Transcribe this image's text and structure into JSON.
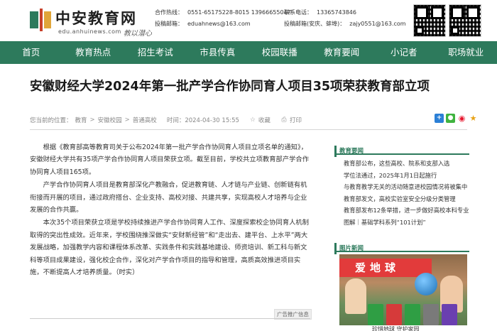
{
  "header": {
    "logo_text": "中安教育网",
    "logo_url": "edu.anhuinews.com",
    "logo_signature": "教以潜心",
    "contacts": {
      "coop_label": "合作热线：",
      "coop_value": "0551-65175228-8015 13966655047",
      "submit_label": "投稿邮箱：",
      "submit_value": "eduahnews@163.com",
      "phone_label": "联系电话：",
      "phone_value": "13365743846",
      "branch_label": "投稿邮箱(安庆、蚌埠)：",
      "branch_value": "zajy0551@163.com"
    }
  },
  "nav": {
    "items": [
      "首页",
      "教育热点",
      "招生考试",
      "市县传真",
      "校园联播",
      "教育要闻",
      "小记者",
      "职场就业"
    ]
  },
  "article": {
    "title": "安徽财经大学2024年第一批产学合作协同育人项目35项荣获教育部立项",
    "meta": {
      "location_label": "您当前的位置：",
      "crumb1": "教育",
      "crumb2": "安徽校园",
      "crumb3": "普通高校",
      "time": "时间：2024-04-30 15:55",
      "favorite": "收藏",
      "print": "打印"
    },
    "paragraphs": [
      "根据《教育部高等教育司关于公布2024年第一批产学合作协同育人项目立项名单的通知》，安徽财经大学共有35项产学合作协同育人项目荣获立项。截至目前，学校共立项教育部产学合作协同育人项目165项。",
      "产学合作协同育人项目是教育部深化产教融合，促进教育链、人才链与产业链、创新链有机衔接而开展的项目，通过政府搭台、企业支持、高校对接、共建共享，实现高校人才培养与企业发展的合作共赢。",
      "本次35个项目荣获立项是学校持续推进产学合作协同育人工作、深度探索校企协同育人机制取得的突出性成效。近年来，学校围绕推深做实“安财新经管”和“走出去、建平台、上水平”两大发展战略，加强教学内容和课程体系改革、实践条件和实践基地建设、师资培训、新工科与新文科等项目成果建设，强化校企合作，深化对产学合作项目的指导和管理，高质高效推进项目实施，不断提高人才培养质量。（时实）"
    ],
    "ad_label": "广告推广信息"
  },
  "sidebar": {
    "news_title": "教育要闻",
    "news_items": [
      "教育部公布，这些高校、院系和支部入选",
      "学位法通过，2025年1月1日起施行",
      "与教育教学无关的活动随意进校园情况将被集中",
      "教育部发文，高校实验室安全分级分类管理",
      "教育部发布12条举措，进一步做好高校本科专业",
      "图解｜基础学科系列“101计划”"
    ],
    "pic_title": "图片新闻",
    "pic_banner": "爱地球",
    "pic_caption": "珍惜地球 守护家园"
  },
  "colors": {
    "brand_green": "#2d7a5c",
    "accent_red": "#c8402a"
  },
  "icons": {
    "favorite": "star-icon",
    "print": "printer-icon",
    "share": [
      "share-plus-icon",
      "wechat-icon",
      "weibo-icon",
      "star-share-icon"
    ]
  }
}
